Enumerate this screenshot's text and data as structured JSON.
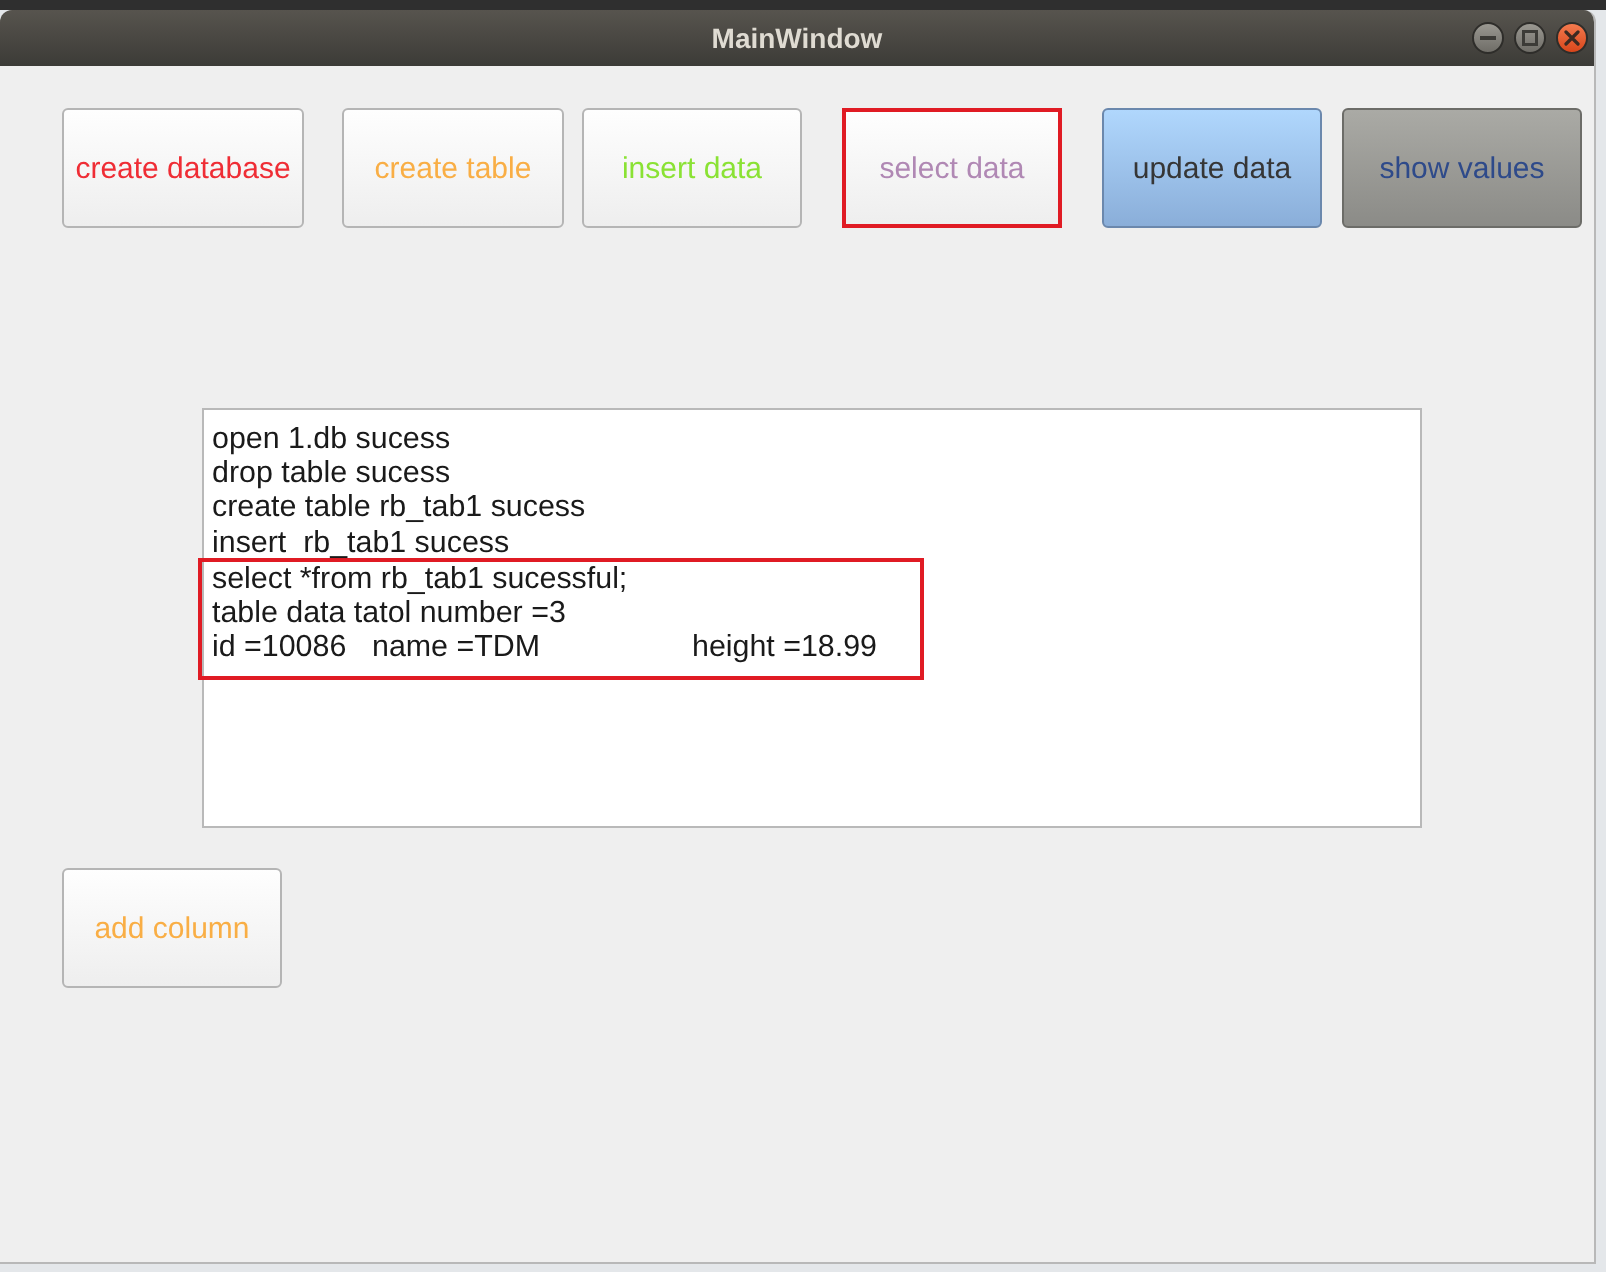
{
  "window": {
    "title": "MainWindow"
  },
  "buttons": [
    {
      "label": "create database",
      "color": "#ef2d35",
      "kind": "plain",
      "highlighted": false
    },
    {
      "label": "create table",
      "color": "#f9ae45",
      "kind": "plain",
      "highlighted": false
    },
    {
      "label": "insert data",
      "color": "#8ae234",
      "kind": "plain",
      "highlighted": false
    },
    {
      "label": "select data",
      "color": "#b088b4",
      "kind": "plain",
      "highlighted": true
    },
    {
      "label": "update data",
      "color": "#363636",
      "kind": "blue",
      "highlighted": false
    },
    {
      "label": "show values",
      "color": "#2e4a8a",
      "kind": "gray",
      "highlighted": false
    }
  ],
  "output": {
    "blocks": [
      {
        "highlighted": false,
        "lines": [
          "open 1.db sucess",
          "drop table sucess",
          "create table rb_tab1 sucess",
          "insert  rb_tab1 sucess"
        ]
      },
      {
        "highlighted": true,
        "lines": [
          "select *from rb_tab1 sucessful;",
          "table data tatol number =3",
          "id =10086\tname =TDM\theight =18.99"
        ]
      }
    ]
  },
  "lower_buttons": [
    {
      "label": "add column",
      "color": "#f9ae45",
      "kind": "plain",
      "highlighted": false
    }
  ]
}
